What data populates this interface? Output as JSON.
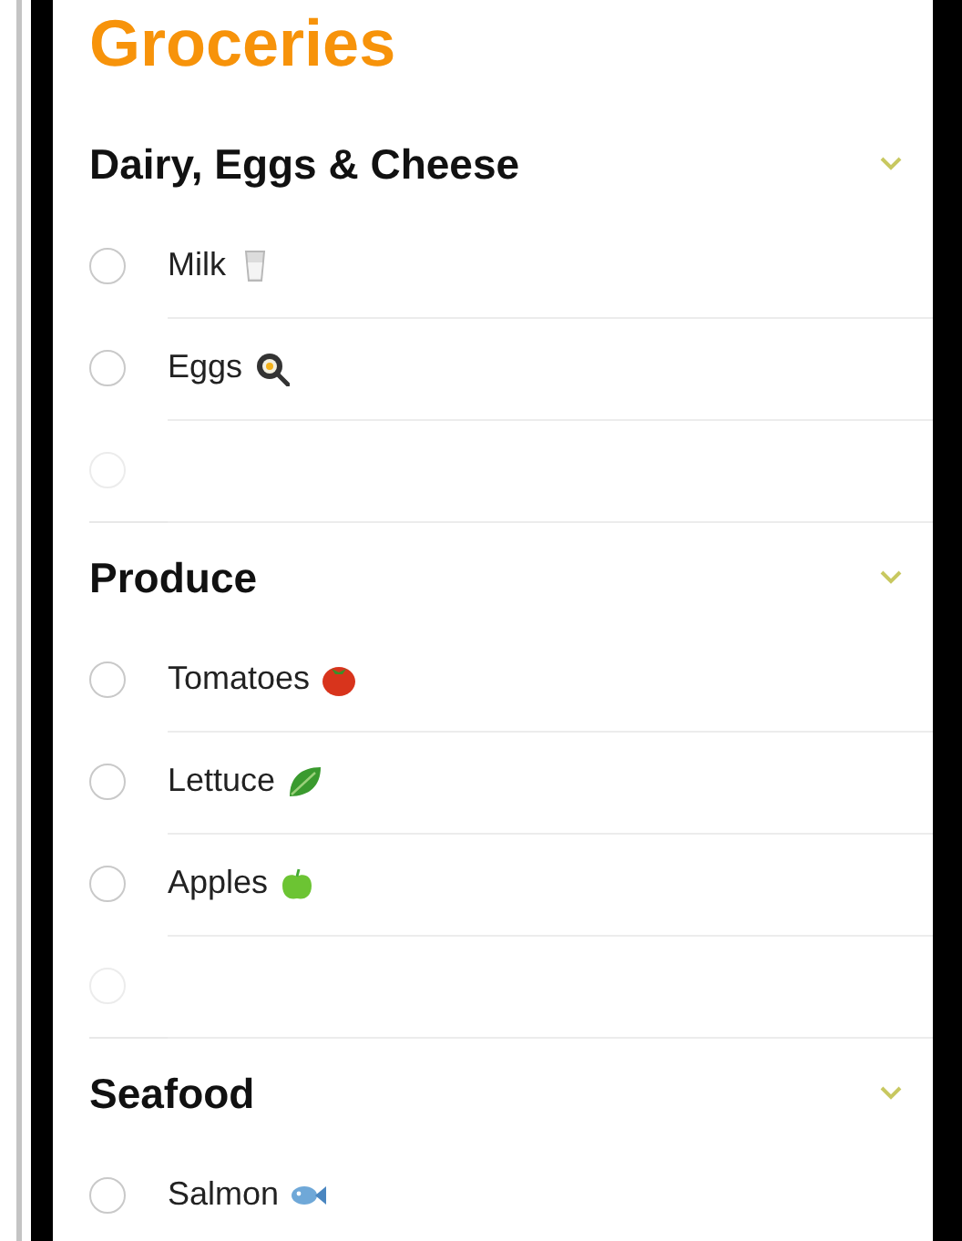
{
  "title": "Groceries",
  "sections": [
    {
      "name": "Dairy, Eggs & Cheese",
      "expanded": true,
      "items": [
        {
          "kind": "item",
          "label": "Milk",
          "icon": {
            "kind": "glass"
          },
          "checked": false
        },
        {
          "kind": "item",
          "label": "Eggs",
          "icon": {
            "kind": "pan"
          },
          "checked": false
        },
        {
          "kind": "new"
        }
      ]
    },
    {
      "name": "Produce",
      "expanded": true,
      "items": [
        {
          "kind": "item",
          "label": "Tomatoes",
          "icon": {
            "kind": "tomato"
          },
          "checked": false
        },
        {
          "kind": "item",
          "label": "Lettuce",
          "icon": {
            "kind": "leaf"
          },
          "checked": false
        },
        {
          "kind": "item",
          "label": "Apples",
          "icon": {
            "kind": "apple"
          },
          "checked": false
        },
        {
          "kind": "new"
        }
      ]
    },
    {
      "name": "Seafood",
      "expanded": true,
      "items": [
        {
          "kind": "item",
          "label": "Salmon",
          "icon": {
            "kind": "fish"
          },
          "checked": false
        }
      ]
    }
  ]
}
